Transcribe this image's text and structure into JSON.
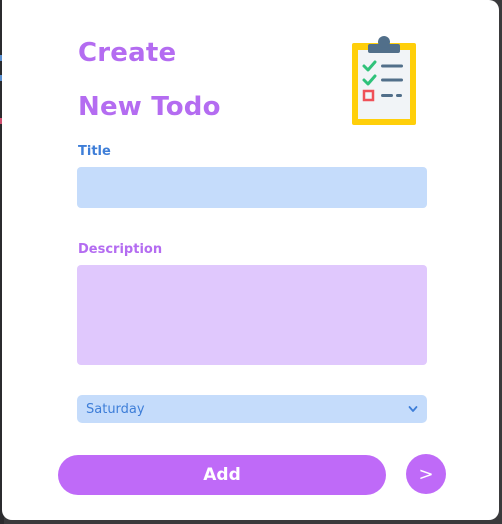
{
  "header": {
    "title_line1": "Create",
    "title_line2": "New Todo",
    "icon": "clipboard-checklist-icon"
  },
  "form": {
    "title_label": "Title",
    "title_value": "",
    "description_label": "Description",
    "description_value": "",
    "day_select": {
      "selected": "Saturday"
    },
    "add_label": "Add",
    "next_label": ">"
  },
  "colors": {
    "accent_purple": "#bf6af8",
    "title_purple": "#b46cf1",
    "label_blue": "#3e7ed8",
    "input_blue": "#c5dcfb",
    "input_lavender": "#e0c8fd"
  }
}
